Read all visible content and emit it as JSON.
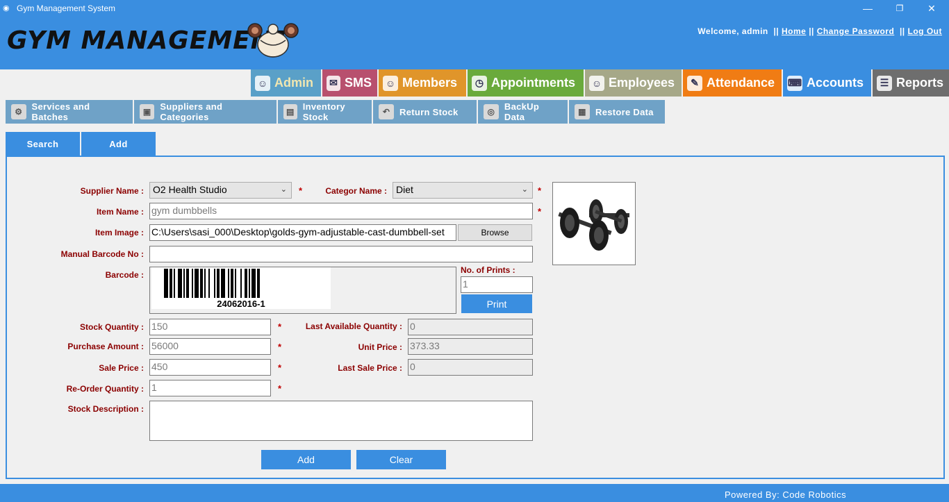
{
  "window": {
    "title": "Gym Management System",
    "minimize": "—",
    "maximize": "❐",
    "close": "✕"
  },
  "header": {
    "logo_text": "GYM MANAGEMENT",
    "welcome": "Welcome, admin",
    "sep": "||",
    "home": "Home",
    "change_password": "Change Password",
    "logout": "Log Out"
  },
  "main_nav": [
    {
      "label": "Admin",
      "color": "#5aa0c8",
      "text_color": "#f0e6b0",
      "icon": "admin-icon"
    },
    {
      "label": "SMS",
      "color": "#b8506e",
      "text_color": "#ffffff",
      "icon": "sms-icon"
    },
    {
      "label": "Members",
      "color": "#e0952a",
      "text_color": "#ffffff",
      "icon": "members-icon"
    },
    {
      "label": "Appointments",
      "color": "#6aaa3c",
      "text_color": "#ffffff",
      "icon": "appointments-icon"
    },
    {
      "label": "Employees",
      "color": "#a6a888",
      "text_color": "#ffffff",
      "icon": "employees-icon"
    },
    {
      "label": "Attendance",
      "color": "#f07c14",
      "text_color": "#ffffff",
      "icon": "attendance-icon"
    },
    {
      "label": "Accounts",
      "color": "#3a8ee0",
      "text_color": "#ffffff",
      "icon": "accounts-icon"
    },
    {
      "label": "Reports",
      "color": "#6e6e6e",
      "text_color": "#ffffff",
      "icon": "reports-icon"
    }
  ],
  "sub_nav": [
    {
      "label": "Services and Batches",
      "icon": "gears-icon"
    },
    {
      "label": "Suppliers and Categories",
      "icon": "box-icon"
    },
    {
      "label": "Inventory Stock",
      "icon": "stock-icon"
    },
    {
      "label": "Return Stock",
      "icon": "return-icon"
    },
    {
      "label": "BackUp Data",
      "icon": "backup-icon"
    },
    {
      "label": "Restore Data",
      "icon": "restore-icon"
    }
  ],
  "form_tabs": {
    "search": "Search",
    "add": "Add"
  },
  "form": {
    "supplier_label": "Supplier Name :",
    "supplier_value": "O2 Health Studio",
    "category_label": "Categor Name :",
    "category_value": "Diet",
    "item_name_label": "Item Name :",
    "item_name_value": "gym dumbbells",
    "item_image_label": "Item Image :",
    "item_image_value": "C:\\Users\\sasi_000\\Desktop\\golds-gym-adjustable-cast-dumbbell-set",
    "browse": "Browse",
    "manual_barcode_label": "Manual Barcode No :",
    "manual_barcode_value": "",
    "barcode_label": "Barcode :",
    "barcode_text": "24062016-1",
    "prints_label": "No. of Prints :",
    "prints_value": "1",
    "print_button": "Print",
    "stock_qty_label": "Stock Quantity :",
    "stock_qty_value": "150",
    "last_avail_label": "Last Available Quantity :",
    "last_avail_value": "0",
    "purchase_label": "Purchase Amount :",
    "purchase_value": "56000",
    "unit_price_label": "Unit Price :",
    "unit_price_value": "373.33",
    "sale_price_label": "Sale Price :",
    "sale_price_value": "450",
    "last_sale_label": "Last Sale Price :",
    "last_sale_value": "0",
    "reorder_label": "Re-Order Quantity :",
    "reorder_value": "1",
    "desc_label": "Stock Description :",
    "desc_value": "",
    "required": "*",
    "add_button": "Add",
    "clear_button": "Clear"
  },
  "footer": {
    "text": "Powered By: Code Robotics"
  }
}
